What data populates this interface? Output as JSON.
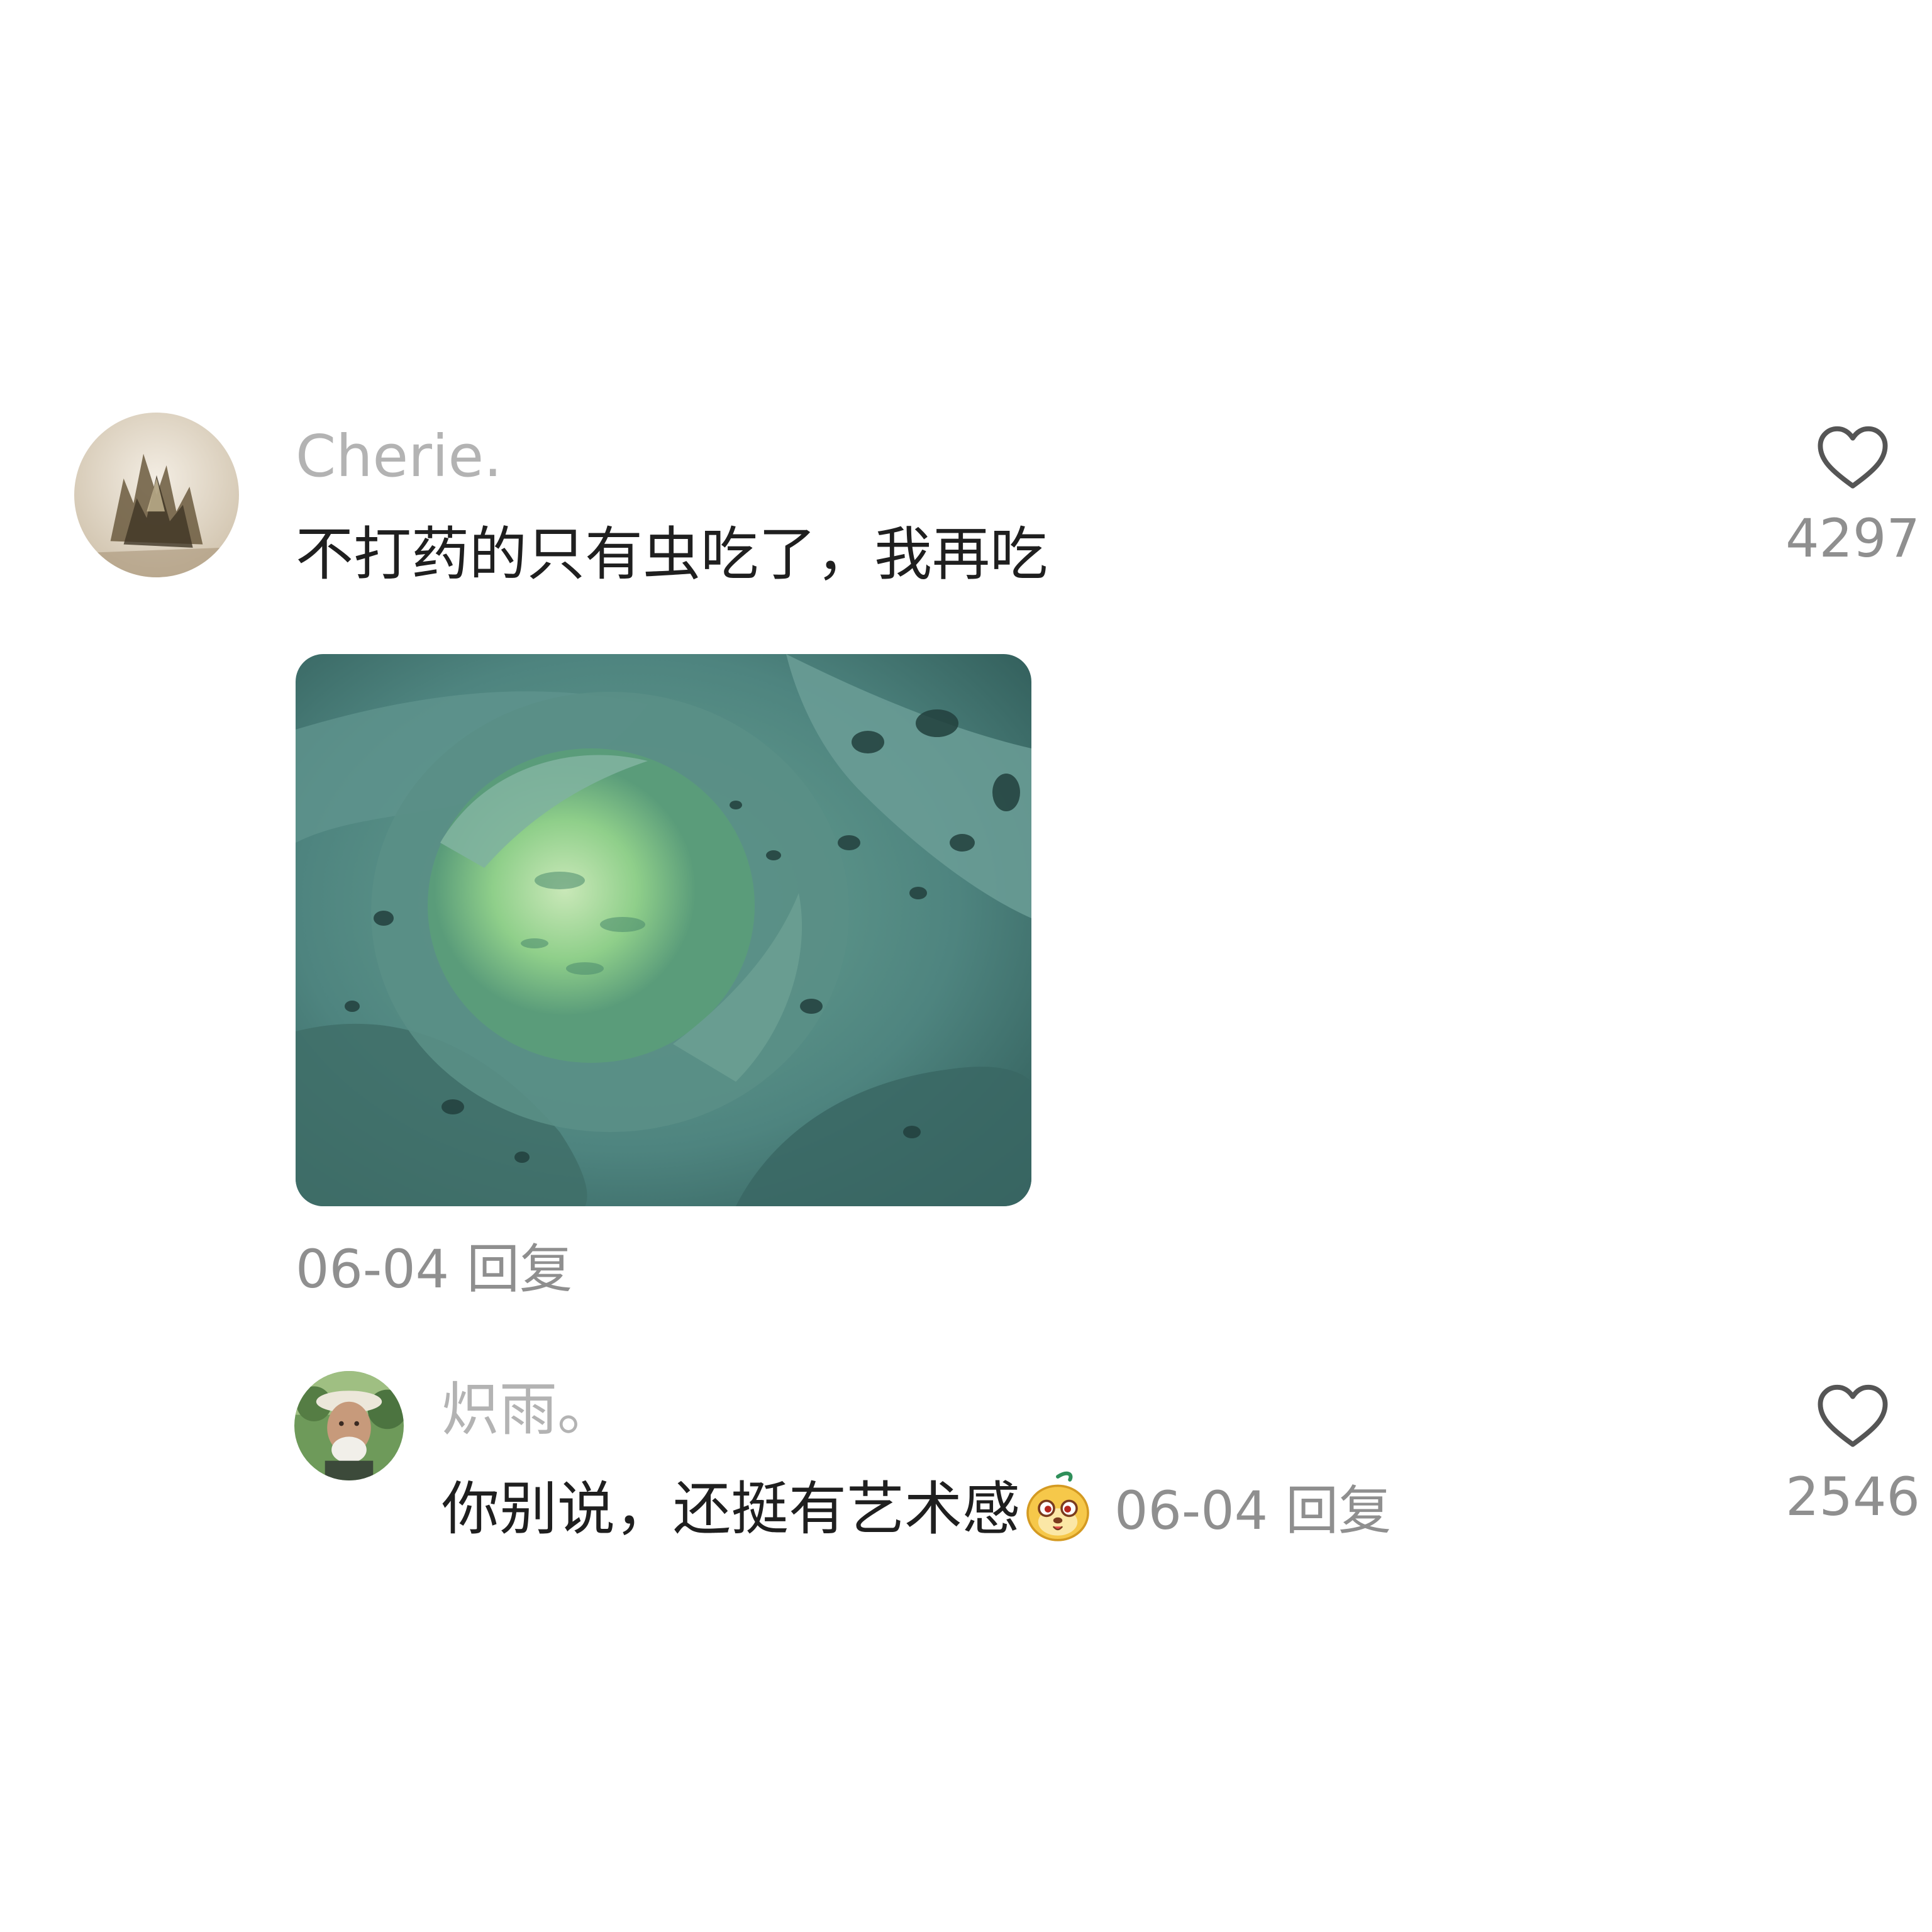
{
  "comments": [
    {
      "username": "Cherie.",
      "text": "不打药的只有虫吃了，我再吃",
      "date": "06-04",
      "reply_label": "回复",
      "likes": "4297",
      "avatar_icon": "crystal-photo-avatar",
      "image_icon": "cabbage-photo"
    },
    {
      "username": "炽雨。",
      "text": "你别说，还挺有艺术感",
      "emoji_icon": "yellow-cartoon-emoji",
      "date": "06-04",
      "reply_label": "回复",
      "likes": "2546",
      "avatar_icon": "elderly-man-photo-avatar"
    }
  ],
  "colors": {
    "background": "#ffffff",
    "username": "#b3b3b3",
    "text": "#1f1f1f",
    "meta": "#8f8f8f",
    "heart_outline": "#555555"
  }
}
